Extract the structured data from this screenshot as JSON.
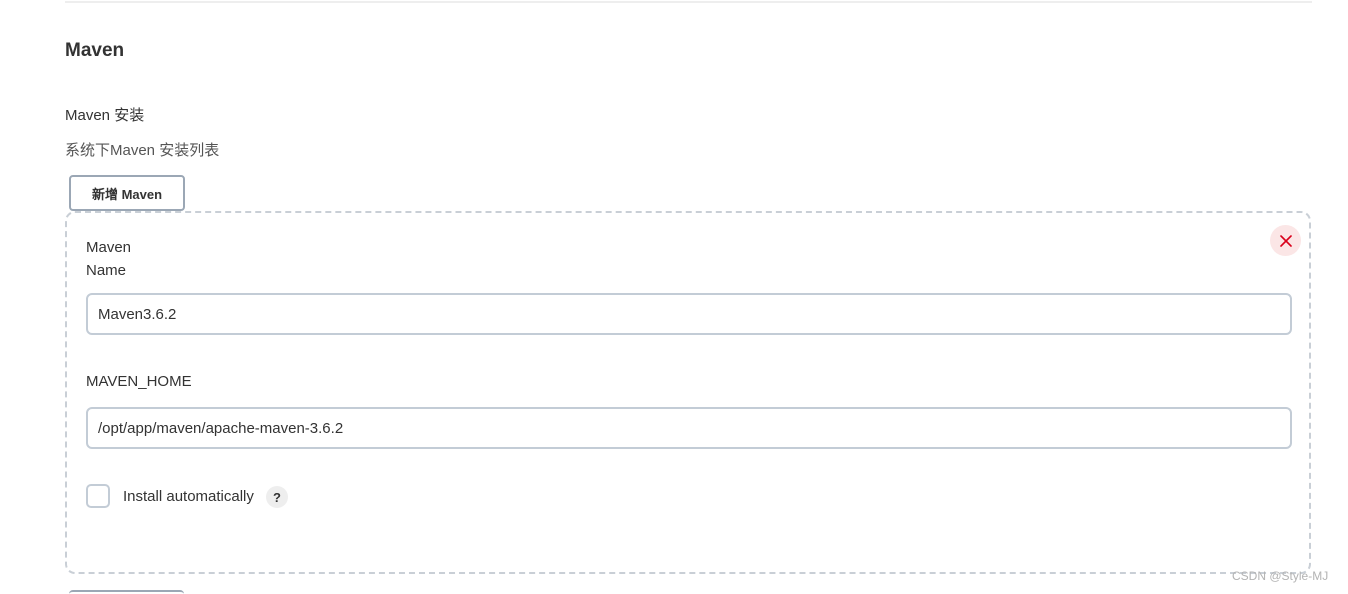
{
  "section": {
    "title": "Maven",
    "install_label": "Maven 安装",
    "install_desc": "系统下Maven 安装列表",
    "add_button_label": "新增 Maven"
  },
  "installation": {
    "name_label_line1": "Maven",
    "name_label_line2": "Name",
    "name_value": "Maven3.6.2",
    "home_label": "MAVEN_HOME",
    "home_value": "/opt/app/maven/apache-maven-3.6.2",
    "install_auto_label": "Install automatically",
    "install_auto_checked": false,
    "help_glyph": "?",
    "delete_icon": "close-icon",
    "delete_color": "#d9001b"
  },
  "watermark": "CSDN @Style-MJ"
}
